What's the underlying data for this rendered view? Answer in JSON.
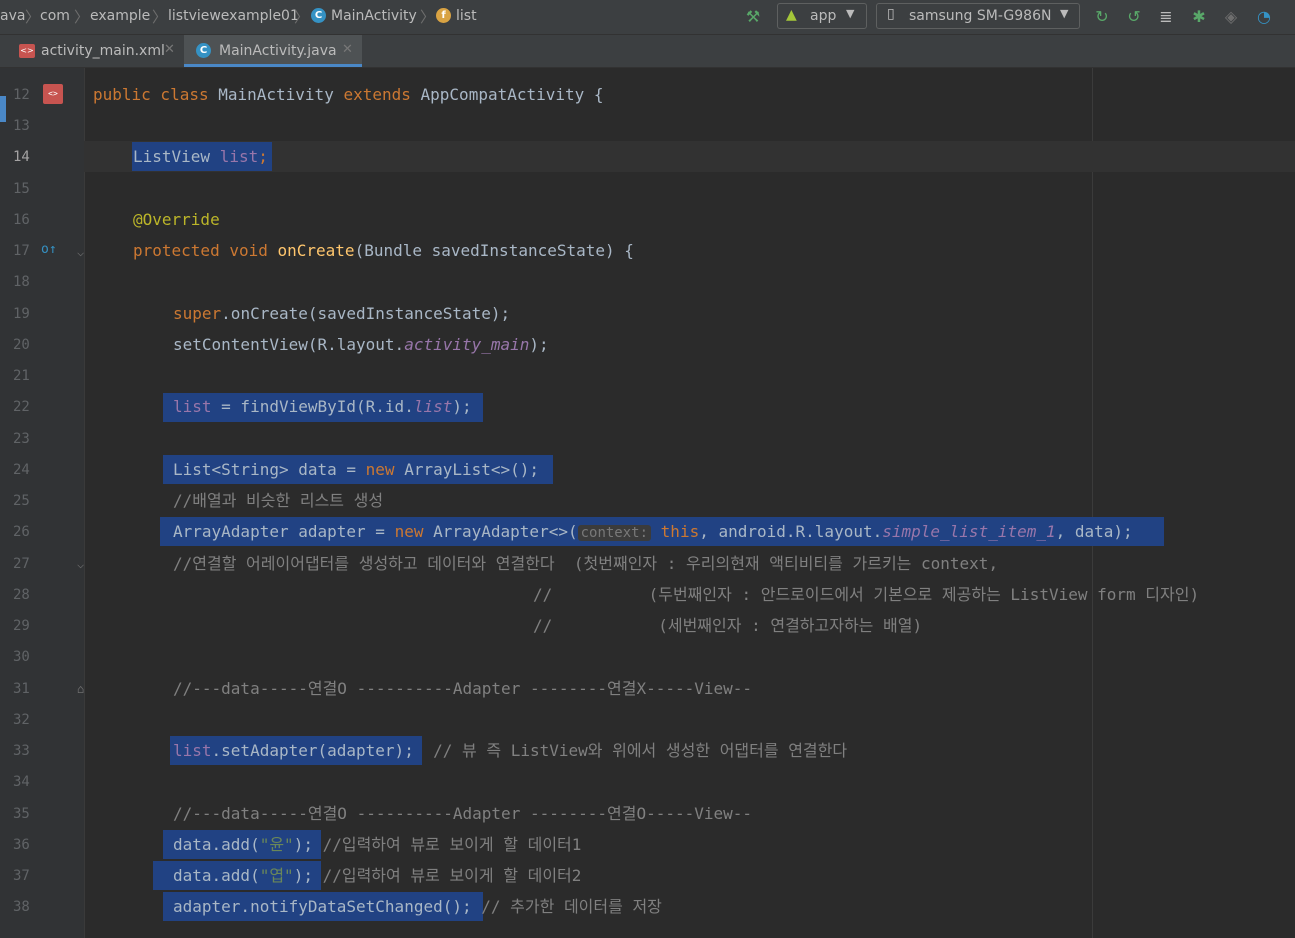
{
  "breadcrumbs": [
    "ava",
    "com",
    "example",
    "listviewexample01",
    "MainActivity",
    "list"
  ],
  "toolbar": {
    "run_config": "app",
    "device": "samsung SM-G986N",
    "icons": [
      "hammer-icon",
      "rerun-icon",
      "apply-changes-icon",
      "apply-code-changes-icon",
      "debug-icon",
      "attach-debugger-icon",
      "profiler-icon"
    ]
  },
  "tabs": [
    {
      "label": "activity_main.xml",
      "icon": "xml-file-icon",
      "active": false
    },
    {
      "label": "MainActivity.java",
      "icon": "java-class-icon",
      "active": true
    }
  ],
  "editor": {
    "line_numbers": [
      "12",
      "13",
      "14",
      "15",
      "16",
      "17",
      "18",
      "19",
      "20",
      "21",
      "22",
      "23",
      "24",
      "25",
      "26",
      "27",
      "28",
      "29",
      "30",
      "31",
      "32",
      "33",
      "34",
      "35",
      "36",
      "37",
      "38"
    ],
    "current_line": "14",
    "param_hint": "context:",
    "lines": {
      "l12": {
        "kw": "public class",
        "name": " MainActivity ",
        "kw2": "extends",
        "rest": " AppCompatActivity {"
      },
      "l14": {
        "type": "ListView ",
        "field": "list",
        "semi": ";"
      },
      "l16": {
        "ann": "@Override"
      },
      "l17": {
        "kw": "protected void",
        "fn": " onCreate",
        "rest": "(Bundle savedInstanceState) {"
      },
      "l19": {
        "kw": "super",
        "rest": ".onCreate(savedInstanceState);"
      },
      "l20": {
        "a": "setContentView(R.layout.",
        "field": "activity_main",
        "b": ");"
      },
      "l22": {
        "field": "list",
        "a": " = findViewById(R.id.",
        "field2": "list",
        "b": ");"
      },
      "l24": {
        "a": "List<String> data = ",
        "kw": "new",
        "b": " ArrayList<>();"
      },
      "l25": {
        "comment": "//배열과 비슷한 리스트 생성"
      },
      "l26": {
        "a": "ArrayAdapter adapter = ",
        "kw": "new",
        "b": " ArrayAdapter<>(",
        "kw2": "this",
        "c": ", android.R.layout.",
        "field": "simple_list_item_1",
        "d": ", data);"
      },
      "l27": {
        "comment": "//연결할 어레이어댑터를 생성하고 데이터와 연결한다  (첫번째인자 : 우리의현재 액티비티를 가르키는 context,"
      },
      "l28": {
        "comment": "//          (두번째인자 : 안드로이드에서 기본으로 제공하는 ListView form 디자인)"
      },
      "l29": {
        "comment": "//           (세번째인자 : 연결하고자하는 배열)"
      },
      "l31": {
        "comment": "//---data-----연결O ----------Adapter --------연결X-----View--"
      },
      "l33": {
        "field": "list",
        "a": ".setAdapter(adapter);",
        "comment": "  // 뷰 즉 ListView와 위에서 생성한 어댑터를 연결한다"
      },
      "l35": {
        "comment": "//---data-----연결O ----------Adapter --------연결O-----View--"
      },
      "l36": {
        "a": "data.add(",
        "str": "\"윤\"",
        "b": ");",
        "comment": " //입력하여 뷰로 보이게 할 데이터1"
      },
      "l37": {
        "a": "data.add(",
        "str": "\"엽\"",
        "b": ");",
        "comment": " //입력하여 뷰로 보이게 할 데이터2"
      },
      "l38": {
        "a": "adapter.notifyDataSetChanged();",
        "comment": " // 추가한 데이터를 저장"
      }
    }
  },
  "colors": {
    "background": "#2b2b2b",
    "keyword": "#cc7832",
    "field": "#9876aa",
    "function": "#ffc66d",
    "annotation": "#bbb529",
    "string": "#6a8759",
    "comment": "#808080",
    "selection": "#214283"
  }
}
